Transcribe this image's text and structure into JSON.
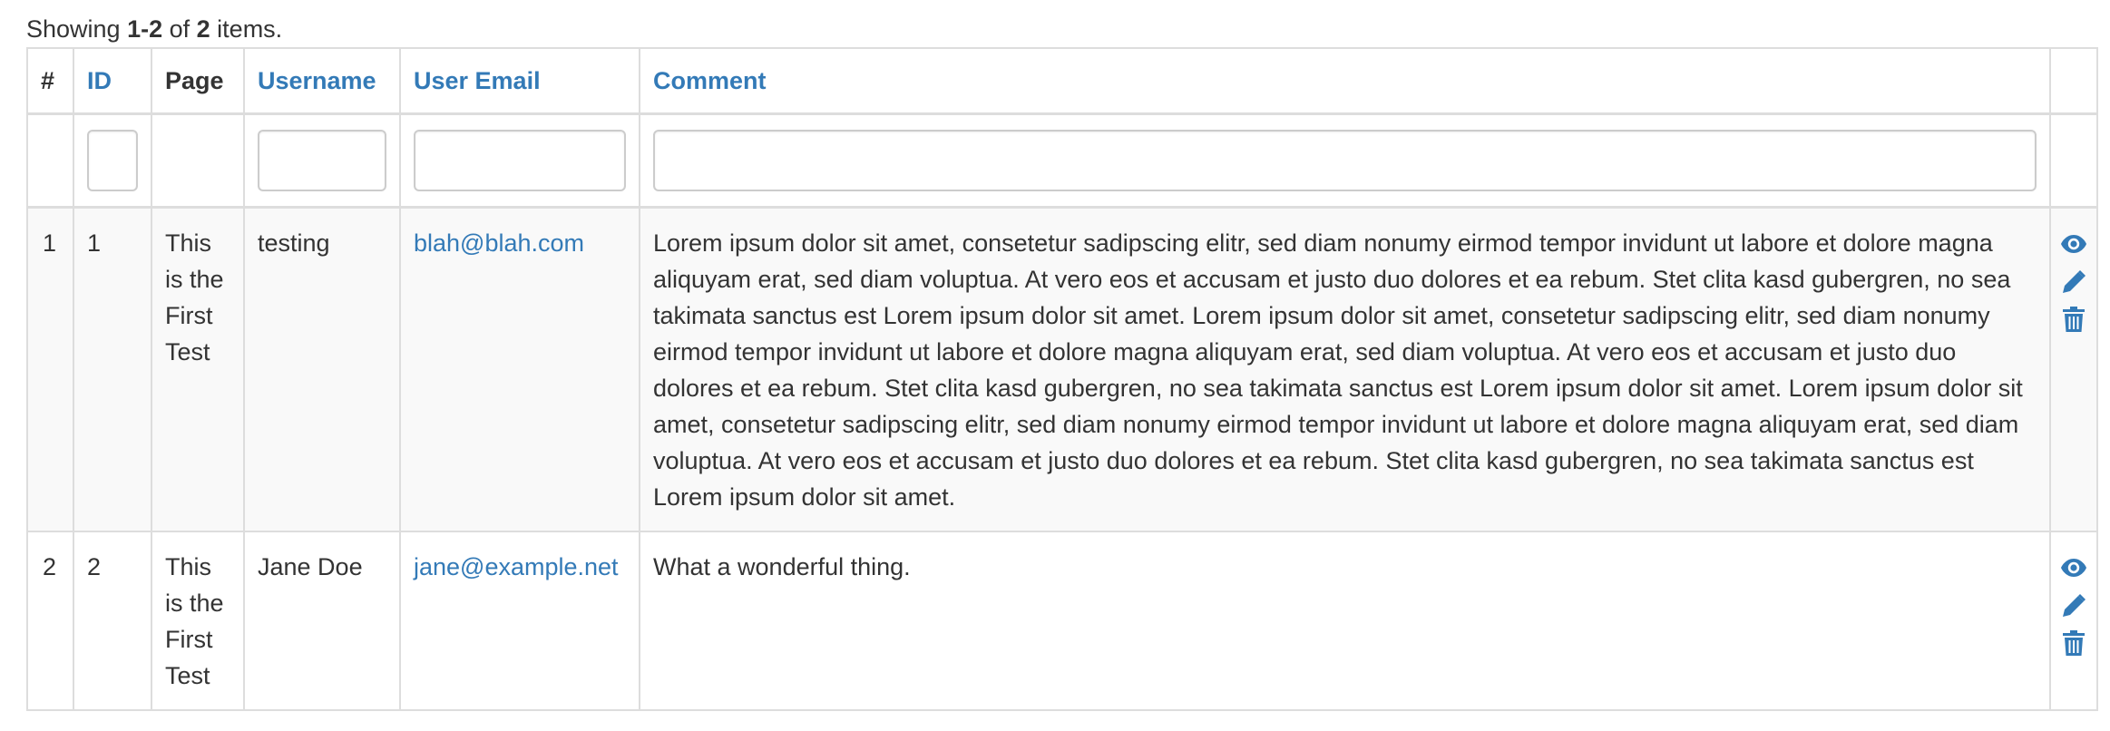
{
  "summary": {
    "prefix": "Showing ",
    "range": "1-2",
    "middle": " of ",
    "total": "2",
    "suffix": " items."
  },
  "columns": {
    "serial": "#",
    "id": "ID",
    "page": "Page",
    "username": "Username",
    "email": "User Email",
    "comment": "Comment"
  },
  "filters": {
    "id": "",
    "username": "",
    "email": "",
    "comment": ""
  },
  "rows": [
    {
      "serial": "1",
      "id": "1",
      "page": "This is the First Test",
      "username": "testing",
      "email": "blah@blah.com",
      "comment": "Lorem ipsum dolor sit amet, consetetur sadipscing elitr, sed diam nonumy eirmod tempor invidunt ut labore et dolore magna aliquyam erat, sed diam voluptua. At vero eos et accusam et justo duo dolores et ea rebum. Stet clita kasd gubergren, no sea takimata sanctus est Lorem ipsum dolor sit amet. Lorem ipsum dolor sit amet, consetetur sadipscing elitr, sed diam nonumy eirmod tempor invidunt ut labore et dolore magna aliquyam erat, sed diam voluptua. At vero eos et accusam et justo duo dolores et ea rebum. Stet clita kasd gubergren, no sea takimata sanctus est Lorem ipsum dolor sit amet. Lorem ipsum dolor sit amet, consetetur sadipscing elitr, sed diam nonumy eirmod tempor invidunt ut labore et dolore magna aliquyam erat, sed diam voluptua. At vero eos et accusam et justo duo dolores et ea rebum. Stet clita kasd gubergren, no sea takimata sanctus est Lorem ipsum dolor sit amet."
    },
    {
      "serial": "2",
      "id": "2",
      "page": "This is the First Test",
      "username": "Jane Doe",
      "email": "jane@example.net",
      "comment": "What a wonderful thing."
    }
  ],
  "action_icons": [
    "eye-icon",
    "pencil-icon",
    "trash-icon"
  ],
  "colors": {
    "link": "#337ab7",
    "text": "#333333",
    "border": "#dddddd",
    "stripe": "#f9f9f9"
  }
}
